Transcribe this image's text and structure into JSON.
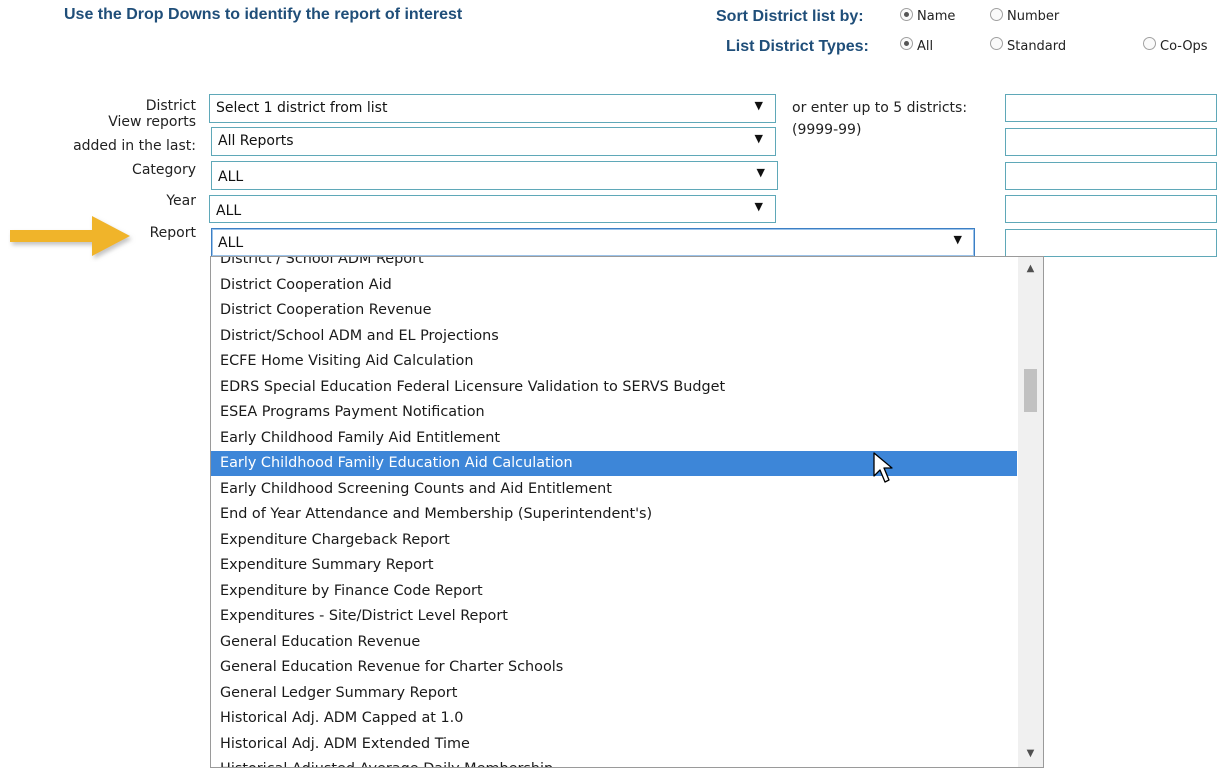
{
  "header": {
    "instruction": "Use the Drop Downs to identify the report of interest",
    "sort_label": "Sort District list by:",
    "sort_options": [
      {
        "label": "Name",
        "checked": true
      },
      {
        "label": "Number",
        "checked": false
      }
    ],
    "types_label": "List District Types:",
    "type_options": [
      {
        "label": "All",
        "checked": true
      },
      {
        "label": "Standard",
        "checked": false
      },
      {
        "label": "Co-Ops",
        "checked": false
      }
    ]
  },
  "form": {
    "district_label": "District",
    "district_value": "Select 1 district from list",
    "view_label_line1": "View reports",
    "view_label_line2": "added in the last:",
    "view_value": "All Reports",
    "category_label": "Category",
    "category_value": "ALL",
    "year_label": "Year",
    "year_value": "ALL",
    "report_label": "Report",
    "report_value": "ALL",
    "alt_label_line1": "or enter up to 5 districts:",
    "alt_label_line2": "(9999-99)"
  },
  "dropdown": {
    "items": [
      "District / School ADM Report",
      "District Cooperation Aid",
      "District Cooperation Revenue",
      "District/School ADM and EL Projections",
      "ECFE Home Visiting Aid Calculation",
      "EDRS Special Education Federal Licensure Validation to SERVS Budget",
      "ESEA Programs Payment Notification",
      "Early Childhood Family Aid Entitlement",
      "Early Childhood Family Education Aid Calculation",
      "Early Childhood Screening Counts and Aid Entitlement",
      "End of Year Attendance and Membership (Superintendent's)",
      "Expenditure Chargeback Report",
      "Expenditure Summary Report",
      "Expenditure by Finance Code Report",
      "Expenditures - Site/District Level Report",
      "General Education Revenue",
      "General Education Revenue for Charter Schools",
      "General Ledger Summary  Report",
      "Historical Adj. ADM Capped at 1.0",
      "Historical Adj. ADM Extended Time",
      "Historical Adjusted Average Daily Membership"
    ],
    "selected_index": 8
  },
  "icons": {
    "arrow": "pointer-arrow-icon",
    "cursor": "mouse-cursor-icon",
    "dropdown": "dropdown-arrow-icon"
  },
  "colors": {
    "heading": "#1f4e79",
    "field_border": "#5fa8b8",
    "selection": "#3d86d8",
    "arrow": "#f0b429"
  }
}
